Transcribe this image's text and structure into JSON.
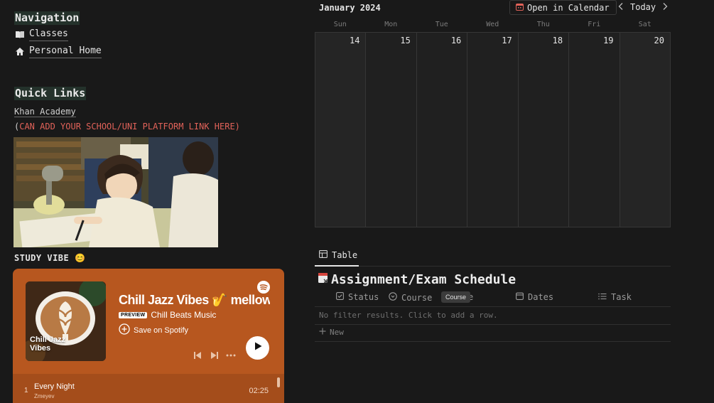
{
  "navigation": {
    "title": "Navigation",
    "items": [
      {
        "label": "Classes",
        "icon": "book-icon"
      },
      {
        "label": "Personal Home",
        "icon": "house-icon"
      }
    ]
  },
  "quick_links": {
    "title": "Quick Links",
    "khan": "Khan Academy",
    "paren_open": "(",
    "custom_link": "CAN ADD YOUR SCHOOL/UNI PLATFORM LINK HERE)"
  },
  "study_vibe": {
    "label": "STUDY VIBE 😊"
  },
  "spotify": {
    "cover_label": "Chill Jazz Vibes",
    "title": "Chill Jazz Vibes 🎷 mellow ja",
    "badge": "PREVIEW",
    "artist": "Chill Beats Music",
    "save": "Save on Spotify",
    "track": {
      "num": "1",
      "name": "Every Night",
      "artist": "Zmeyev",
      "duration": "02:25"
    },
    "colors": {
      "bg": "#b7571f",
      "list_bg": "#a44d1b"
    }
  },
  "calendar": {
    "month": "January 2024",
    "open_button": "Open in Calendar",
    "today": "Today",
    "weekdays": [
      "Sun",
      "Mon",
      "Tue",
      "Wed",
      "Thu",
      "Fri",
      "Sat"
    ],
    "dates": [
      "14",
      "15",
      "16",
      "17",
      "18",
      "19",
      "20"
    ]
  },
  "database": {
    "tab": "Table",
    "title": "Assignment/Exam Schedule",
    "columns": [
      "Status",
      "Course",
      "Dates",
      "Task"
    ],
    "hidden_col_fragment": "e",
    "tooltip": "Course",
    "empty": "No filter results. Click to add a row.",
    "new": "New"
  }
}
